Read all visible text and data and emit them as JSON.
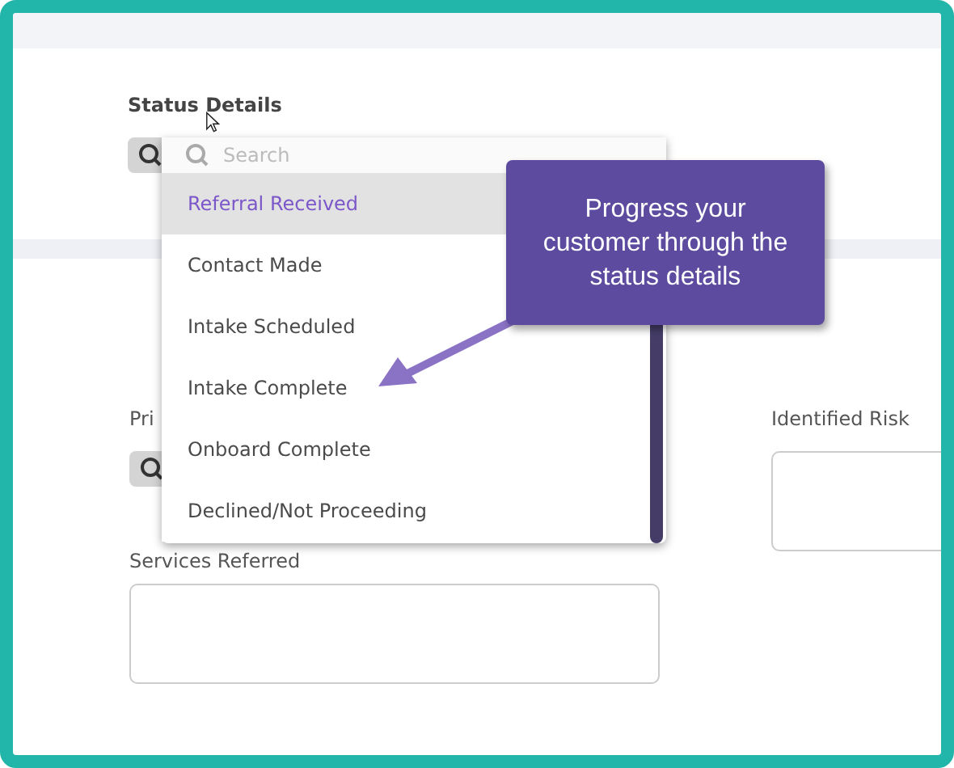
{
  "status_details": {
    "label": "Status Details",
    "search_placeholder": "Search",
    "options": [
      {
        "label": "Referral Received",
        "selected": true
      },
      {
        "label": "Contact Made",
        "selected": false
      },
      {
        "label": "Intake Scheduled",
        "selected": false
      },
      {
        "label": "Intake Complete",
        "selected": false
      },
      {
        "label": "Onboard Complete",
        "selected": false
      },
      {
        "label": "Declined/Not Proceeding",
        "selected": false
      }
    ]
  },
  "tooltip": {
    "text": "Progress your customer through the status details"
  },
  "fields": {
    "column_1_label": "Pri",
    "identified_risk_label": "Identified Risk",
    "services_referred_label": "Services Referred"
  }
}
